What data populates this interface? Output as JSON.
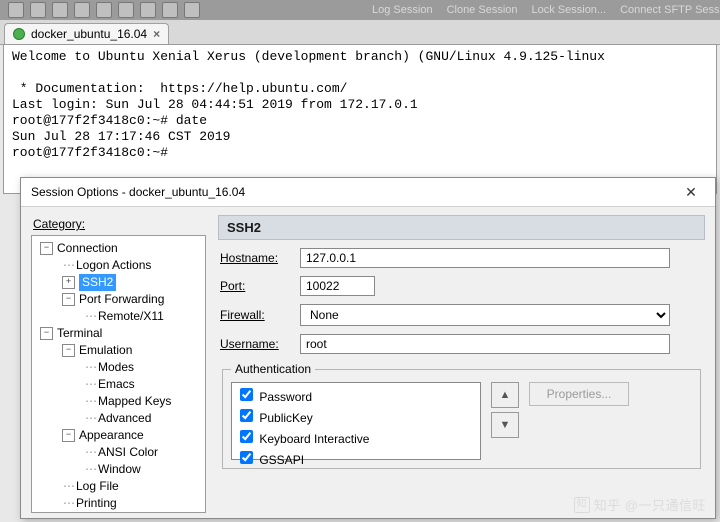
{
  "topbar": {
    "menu_items": [
      "Log Session",
      "Clone Session",
      "Lock Session...",
      "Connect SFTP Sessi"
    ]
  },
  "tab": {
    "label": "docker_ubuntu_16.04",
    "close": "×"
  },
  "terminal": {
    "lines": [
      "Welcome to Ubuntu Xenial Xerus (development branch) (GNU/Linux 4.9.125-linux",
      "",
      " * Documentation:  https://help.ubuntu.com/",
      "Last login: Sun Jul 28 04:44:51 2019 from 172.17.0.1",
      "root@177f2f3418c0:~# date",
      "Sun Jul 28 17:17:46 CST 2019",
      "root@177f2f3418c0:~#"
    ]
  },
  "dialog": {
    "title": "Session Options - docker_ubuntu_16.04",
    "category_label": "Category:",
    "tree": {
      "connection": "Connection",
      "logon_actions": "Logon Actions",
      "ssh2": "SSH2",
      "port_forwarding": "Port Forwarding",
      "remote_x11": "Remote/X11",
      "terminal": "Terminal",
      "emulation": "Emulation",
      "modes": "Modes",
      "emacs": "Emacs",
      "mapped_keys": "Mapped Keys",
      "advanced": "Advanced",
      "appearance": "Appearance",
      "ansi_color": "ANSI Color",
      "window": "Window",
      "log_file": "Log File",
      "printing": "Printing"
    },
    "pane_header": "SSH2",
    "form": {
      "hostname_label": "Hostname:",
      "hostname_value": "127.0.0.1",
      "port_label": "Port:",
      "port_value": "10022",
      "firewall_label": "Firewall:",
      "firewall_value": "None",
      "username_label": "Username:",
      "username_value": "root"
    },
    "auth": {
      "legend": "Authentication",
      "items": [
        "Password",
        "PublicKey",
        "Keyboard Interactive",
        "GSSAPI"
      ],
      "properties_btn": "Properties..."
    }
  },
  "watermark": "知乎 @一只通信旺"
}
